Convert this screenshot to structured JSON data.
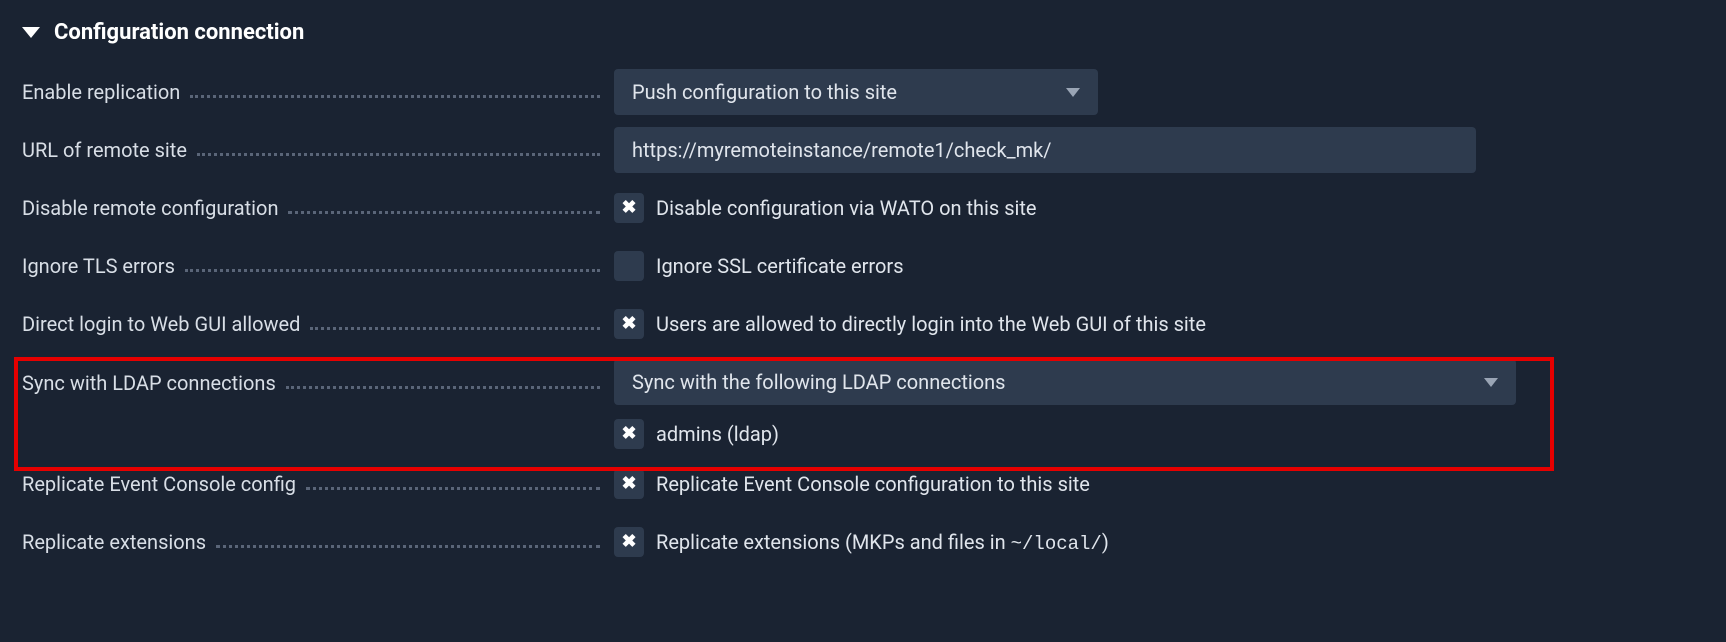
{
  "section": {
    "title": "Configuration connection"
  },
  "fields": {
    "enable_replication": {
      "label": "Enable replication",
      "select_value": "Push configuration to this site"
    },
    "url_remote": {
      "label": "URL of remote site",
      "input_value": "https://myremoteinstance/remote1/check_mk/"
    },
    "disable_remote": {
      "label": "Disable remote configuration",
      "checked": true,
      "checkbox_label": "Disable configuration via WATO on this site"
    },
    "ignore_tls": {
      "label": "Ignore TLS errors",
      "checked": false,
      "checkbox_label": "Ignore SSL certificate errors"
    },
    "direct_login": {
      "label": "Direct login to Web GUI allowed",
      "checked": true,
      "checkbox_label": "Users are allowed to directly login into the Web GUI of this site"
    },
    "sync_ldap": {
      "label": "Sync with LDAP connections",
      "select_value": "Sync with the following LDAP connections",
      "item_checked": true,
      "item_label": "admins (ldap)"
    },
    "replicate_ec": {
      "label": "Replicate Event Console config",
      "checked": true,
      "checkbox_label": "Replicate Event Console configuration to this site"
    },
    "replicate_ext": {
      "label": "Replicate extensions",
      "checked": true,
      "checkbox_label_pre": "Replicate extensions (MKPs and files in ",
      "checkbox_label_mono": "~/local/",
      "checkbox_label_post": ")"
    }
  }
}
